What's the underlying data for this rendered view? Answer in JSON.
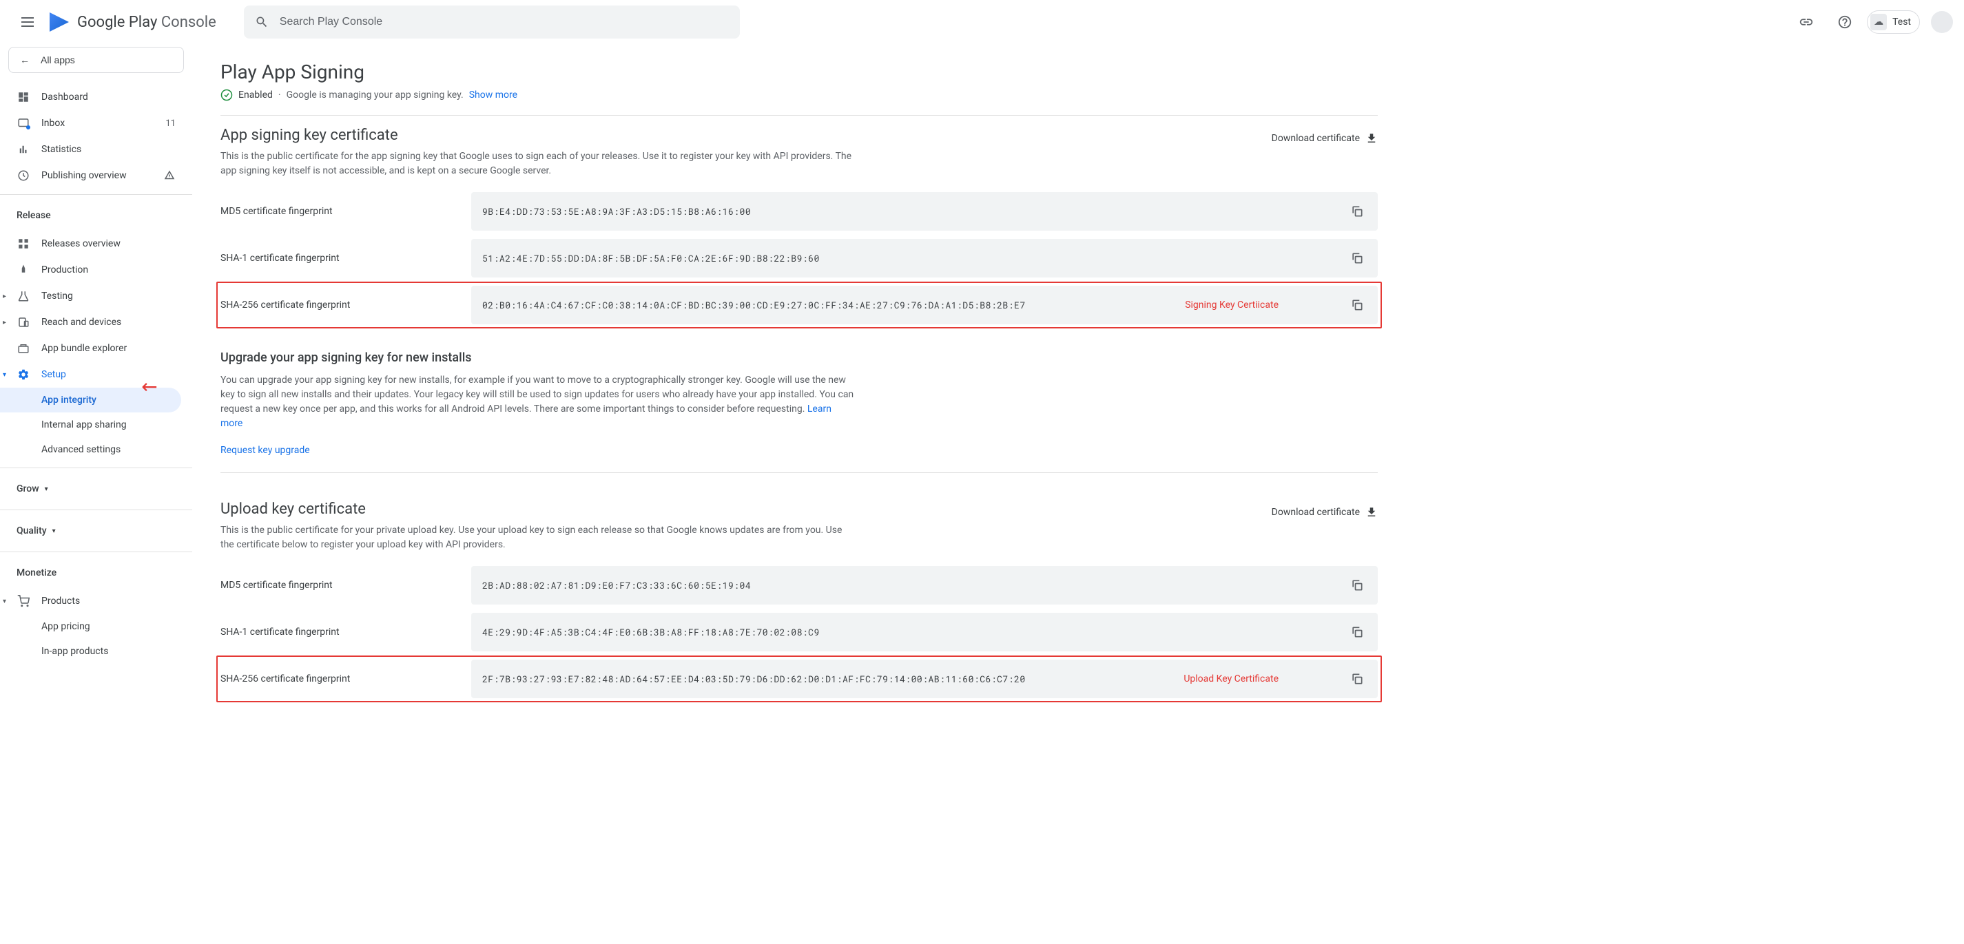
{
  "header": {
    "logo_text_a": "Google Play",
    "logo_text_b": "Console",
    "search_placeholder": "Search Play Console",
    "app_name": "Test"
  },
  "sidebar": {
    "back_label": "All apps",
    "items": {
      "dashboard": "Dashboard",
      "inbox": "Inbox",
      "inbox_count": "11",
      "statistics": "Statistics",
      "publishing": "Publishing overview"
    },
    "release_section": "Release",
    "releases_overview": "Releases overview",
    "production": "Production",
    "testing": "Testing",
    "reach": "Reach and devices",
    "bundle": "App bundle explorer",
    "setup": "Setup",
    "app_integrity": "App integrity",
    "internal_sharing": "Internal app sharing",
    "advanced": "Advanced settings",
    "grow": "Grow",
    "quality": "Quality",
    "monetize": "Monetize",
    "products": "Products",
    "app_pricing": "App pricing",
    "in_app": "In-app products"
  },
  "page": {
    "title": "Play App Signing",
    "status_enabled": "Enabled",
    "status_desc": "Google is managing your app signing key.",
    "show_more": "Show more"
  },
  "signing_cert": {
    "title": "App signing key certificate",
    "desc": "This is the public certificate for the app signing key that Google uses to sign each of your releases. Use it to register your key with API providers. The app signing key itself is not accessible, and is kept on a secure Google server.",
    "download": "Download certificate",
    "md5_label": "MD5 certificate fingerprint",
    "md5_value": "9B:E4:DD:73:53:5E:A8:9A:3F:A3:D5:15:B8:A6:16:00",
    "sha1_label": "SHA-1 certificate fingerprint",
    "sha1_value": "51:A2:4E:7D:55:DD:DA:8F:5B:DF:5A:F0:CA:2E:6F:9D:B8:22:B9:60",
    "sha256_label": "SHA-256 certificate fingerprint",
    "sha256_value": "02:B0:16:4A:C4:67:CF:C0:38:14:0A:CF:BD:BC:39:00:CD:E9:27:0C:FF:34:AE:27:C9:76:DA:A1:D5:B8:2B:E7",
    "annotation": "Signing Key Certiicate"
  },
  "upgrade": {
    "title": "Upgrade your app signing key for new installs",
    "desc": "You can upgrade your app signing key for new installs, for example if you want to move to a cryptographically stronger key. Google will use the new key to sign all new installs and their updates. Your legacy key will still be used to sign updates for users who already have your app installed. You can request a new key once per app, and this works for all Android API levels. There are some important things to consider before requesting.",
    "learn_more": "Learn more",
    "request": "Request key upgrade"
  },
  "upload_cert": {
    "title": "Upload key certificate",
    "desc": "This is the public certificate for your private upload key. Use your upload key to sign each release so that Google knows updates are from you. Use the certificate below to register your upload key with API providers.",
    "download": "Download certificate",
    "md5_label": "MD5 certificate fingerprint",
    "md5_value": "2B:AD:88:02:A7:81:D9:E0:F7:C3:33:6C:60:5E:19:04",
    "sha1_label": "SHA-1 certificate fingerprint",
    "sha1_value": "4E:29:9D:4F:A5:3B:C4:4F:E0:6B:3B:A8:FF:18:A8:7E:70:02:08:C9",
    "sha256_label": "SHA-256 certificate fingerprint",
    "sha256_value": "2F:7B:93:27:93:E7:82:48:AD:64:57:EE:D4:03:5D:79:D6:DD:62:D0:D1:AF:FC:79:14:00:AB:11:60:C6:C7:20",
    "annotation": "Upload Key Certificate"
  }
}
